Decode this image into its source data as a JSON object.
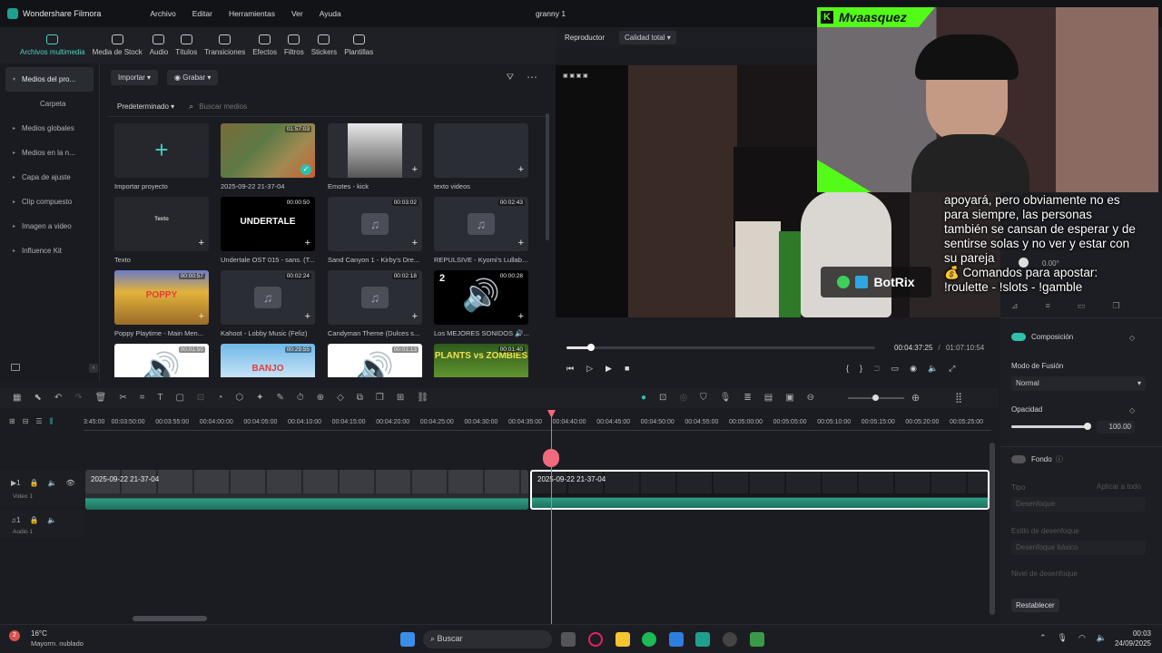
{
  "app": {
    "name": "Wondershare Filmora",
    "project_title": "granny 1"
  },
  "menu": [
    "Archivo",
    "Editar",
    "Herramientas",
    "Ver",
    "Ayuda"
  ],
  "toolbar": [
    {
      "label": "Archivos multimedia",
      "icon": "media-icon",
      "active": true
    },
    {
      "label": "Media de Stock",
      "icon": "stock-icon"
    },
    {
      "label": "Audio",
      "icon": "audio-icon"
    },
    {
      "label": "Títulos",
      "icon": "title-icon"
    },
    {
      "label": "Transiciones",
      "icon": "transition-icon"
    },
    {
      "label": "Efectos",
      "icon": "effects-icon"
    },
    {
      "label": "Filtros",
      "icon": "filter-icon"
    },
    {
      "label": "Stickers",
      "icon": "sticker-icon"
    },
    {
      "label": "Plantillas",
      "icon": "template-icon"
    }
  ],
  "sidebar": [
    {
      "label": "Medios del pro...",
      "selected": true
    },
    {
      "label": "Carpeta",
      "sub": true
    },
    {
      "label": "Medios globales"
    },
    {
      "label": "Medios en la n..."
    },
    {
      "label": "Capa de ajuste"
    },
    {
      "label": "Clip compuesto"
    },
    {
      "label": "Imagen a video"
    },
    {
      "label": "Influence Kit"
    }
  ],
  "media_top": {
    "import": "Importar",
    "record": "Grabar"
  },
  "media_filter": {
    "sort": "Predeterminado",
    "search_placeholder": "Buscar medios"
  },
  "media_items": [
    {
      "label": "Importar proyecto",
      "kind": "import"
    },
    {
      "label": "2025-09-22 21-37-04",
      "duration": "01:57:03",
      "kind": "video-map"
    },
    {
      "label": "Emotes - kick",
      "kind": "image"
    },
    {
      "label": "texto videos",
      "kind": "blank"
    },
    {
      "label": "Texto",
      "kind": "text",
      "inner": "Texto"
    },
    {
      "label": "Undertale OST 015 - sans. (T...",
      "duration": "00:00:50",
      "kind": "undertale",
      "inner": "UNDERTALE"
    },
    {
      "label": "Sand Canyon 1 - Kirby's Dre...",
      "duration": "00:03:02",
      "kind": "audio"
    },
    {
      "label": "REPULSIVE - Kyomi's Lullaby...",
      "duration": "00:02:43",
      "kind": "audio"
    },
    {
      "label": "Poppy Playtime - Main Men...",
      "duration": "00:00:57",
      "kind": "poppy",
      "inner": "POPPY"
    },
    {
      "label": "Kahoot - Lobby Music (Feliz)",
      "duration": "00:02:24",
      "kind": "audio"
    },
    {
      "label": "Candyman Theme (Dulces s...",
      "duration": "00:02:18",
      "kind": "audio"
    },
    {
      "label": "Los MEJORES SONIDOS 🔊...",
      "duration": "00:00:28",
      "kind": "speaker",
      "badge": "2"
    },
    {
      "label": "",
      "duration": "00:01:50",
      "kind": "speaker"
    },
    {
      "label": "",
      "duration": "00:29:55",
      "kind": "banjo",
      "inner": "BANJO"
    },
    {
      "label": "",
      "duration": "00:01:13",
      "kind": "speaker"
    },
    {
      "label": "",
      "duration": "00:01:40",
      "kind": "pvz",
      "inner": "PLANTS vs ZOMBIES"
    }
  ],
  "player": {
    "label": "Reproductor",
    "quality": "Calidad total",
    "current_time": "00:04:37:25",
    "total_time": "01:07:10:54",
    "progress_fraction": 0.08
  },
  "stream_overlay": {
    "streamer": "Mvaasquez",
    "chat_lines": [
      "apoyará, pero obviamente no es",
      "para siempre, las personas",
      "también se cansan de esperar y de",
      "sentirse solas y no ver y estar con",
      "su pareja",
      "💰 Comandos para apostar:",
      "!roulette - !slots - !gamble"
    ],
    "bot": "BotRix",
    "rotation": "0.00°"
  },
  "properties": {
    "composition": "Composición",
    "blend_mode_label": "Modo de Fusión",
    "blend_mode": "Normal",
    "opacity_label": "Opacidad",
    "opacity": "100.00",
    "opacity_fraction": 1.0,
    "background_label": "Fondo",
    "type_label": "Tipo",
    "type_value": "Desenfoque",
    "apply_all": "Aplicar a todo",
    "blur_style_label": "Estilo de desenfoque",
    "blur_style_value": "Desenfoque básico",
    "blur_level_label": "Nivel de desenfoque",
    "reset": "Restablecer"
  },
  "ruler_ticks": [
    "3:45:00",
    "00:03:50:00",
    "00:03:55:00",
    "00:04:00:00",
    "00:04:05:00",
    "00:04:10:00",
    "00:04:15:00",
    "00:04:20:00",
    "00:04:25:00",
    "00:04:30:00",
    "00:04:35:00",
    "00:04:40:00",
    "00:04:45:00",
    "00:04:50:00",
    "00:04:55:00",
    "00:05:00:00",
    "00:05:05:00",
    "00:05:10:00",
    "00:05:15:00",
    "00:05:20:00",
    "00:05:25:00"
  ],
  "tracks": {
    "video": "Video 1",
    "audio": "Audio 1",
    "clip1": "2025-09-22 21-37-04",
    "clip2": "2025-09-22 21-37-04"
  },
  "taskbar": {
    "weather_temp": "16°C",
    "weather_desc": "Mayorm. nublado",
    "weather_badge": "2",
    "search": "Buscar",
    "time": "00:03",
    "date": "24/09/2025"
  }
}
